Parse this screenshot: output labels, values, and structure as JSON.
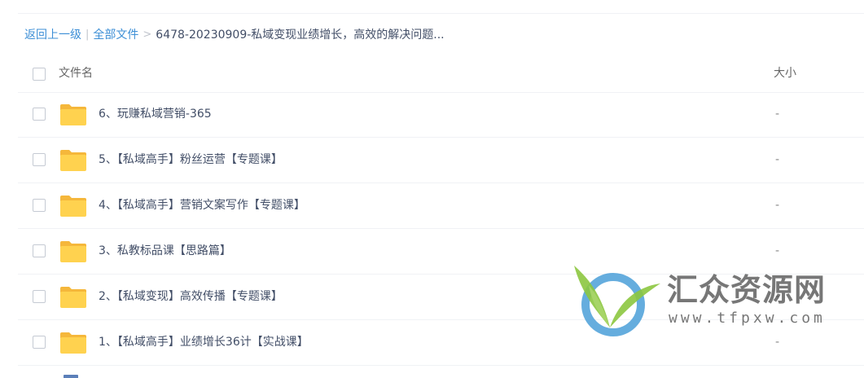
{
  "breadcrumb": {
    "back_label": "返回上一级",
    "separator": "|",
    "root_label": "全部文件",
    "arrow": ">",
    "current_label": "6478-20230909-私域变现业绩增长，高效的解决问题..."
  },
  "list_header": {
    "name_label": "文件名",
    "size_label": "大小"
  },
  "files": [
    {
      "name": "6、玩赚私域营销-365",
      "size": "-"
    },
    {
      "name": "5、【私域高手】粉丝运营【专题课】",
      "size": "-"
    },
    {
      "name": "4、【私域高手】营销文案写作【专题课】",
      "size": "-"
    },
    {
      "name": "3、私教标品课【思路篇】",
      "size": "-"
    },
    {
      "name": "2、【私域变现】高效传播【专题课】",
      "size": "-"
    },
    {
      "name": "1、【私域高手】业绩增长36计【实战课】",
      "size": "-"
    }
  ],
  "watermark": {
    "title": "汇众资源网",
    "url": "www.tfpxw.com"
  },
  "colors": {
    "link": "#3d8fd6",
    "folder": "#ffd24f",
    "folder_back": "#f5b73b",
    "text": "#424e67",
    "divider": "#f0f2f5"
  }
}
